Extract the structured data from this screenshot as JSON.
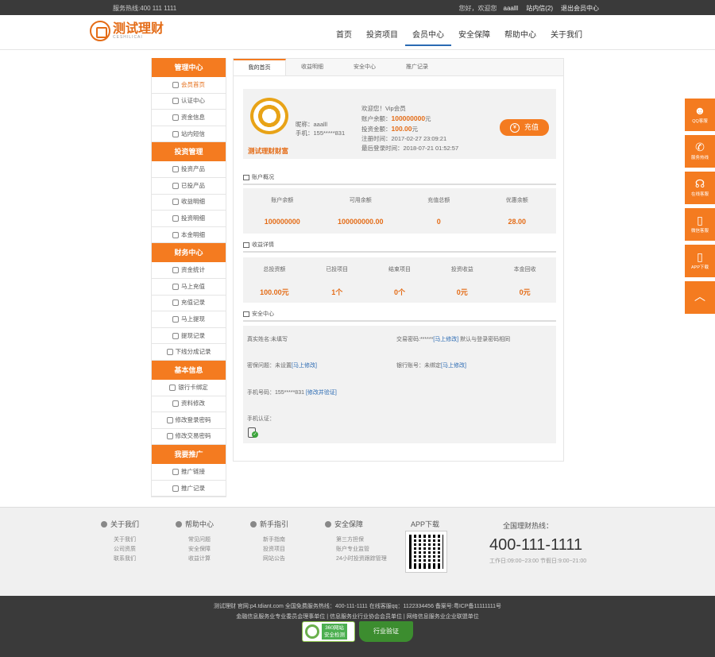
{
  "topbar": {
    "hotline": "服务热线:400 111 1111",
    "greeting": "您好，欢迎您",
    "username": "aaalll",
    "messages": "站内信(2)",
    "logout": "退出会员中心"
  },
  "header": {
    "logo_text": "测试理财",
    "logo_sub": "CESHILICAI",
    "nav": [
      "首页",
      "投资项目",
      "会员中心",
      "安全保障",
      "帮助中心",
      "关于我们"
    ],
    "active_nav": "会员中心"
  },
  "sidebar": {
    "groups": [
      {
        "title": "管理中心",
        "items": [
          "会员首页",
          "认证中心",
          "资金信息",
          "站内短信"
        ]
      },
      {
        "title": "投资管理",
        "items": [
          "投资产品",
          "已投产品",
          "收益明细",
          "投资明细",
          "本金明细"
        ]
      },
      {
        "title": "财务中心",
        "items": [
          "资金统计",
          "马上充值",
          "充值记录",
          "马上提现",
          "提现记录",
          "下线分成记录"
        ]
      },
      {
        "title": "基本信息",
        "items": [
          "银行卡绑定",
          "资料修改",
          "修改登录密码",
          "修改交易密码"
        ]
      },
      {
        "title": "我要推广",
        "items": [
          "推广链接",
          "推广记录"
        ]
      }
    ]
  },
  "tabs": [
    "我的首页",
    "收益明细",
    "安全中心",
    "推广记录"
  ],
  "user": {
    "brand_name": "测试理财财富",
    "nickname": "昵称：aaalll",
    "phone": "手机：155*****831",
    "welcome": "欢迎您！Vip会员",
    "balance_label": "账户余额：",
    "balance_value": "100000000",
    "balance_unit": "元",
    "invest_label": "投资金额：",
    "invest_value": "100.00",
    "invest_unit": "元",
    "register_time": "注册时间：2017-02-27 23:09:21",
    "last_login": "最后登录时间：2018-07-21 01:52:57",
    "recharge_button": "充值",
    "coin_glyph": "¥"
  },
  "account": {
    "title": "账户概况",
    "stats": [
      {
        "label": "账户余额",
        "value": "100000000"
      },
      {
        "label": "可用余额",
        "value": "100000000.00"
      },
      {
        "label": "充值总额",
        "value": "0"
      },
      {
        "label": "优惠余额",
        "value": "28.00"
      }
    ]
  },
  "income": {
    "title": "收益详情",
    "stats": [
      {
        "label": "总投资额",
        "value": "100.00元"
      },
      {
        "label": "已投项目",
        "value": "1个"
      },
      {
        "label": "结束项目",
        "value": "0个"
      },
      {
        "label": "投资收益",
        "value": "0元"
      },
      {
        "label": "本金回收",
        "value": "0元"
      }
    ]
  },
  "security": {
    "title": "安全中心",
    "realname": "真实姓名:未填写",
    "trade_pwd": "交易密码:******",
    "trade_pwd_link": "[马上修改]",
    "trade_pwd_note": "默认与登录密码相同",
    "secret_q": "密保问题：未设置",
    "secret_q_link": "[马上修改]",
    "bank": "银行账号：未绑定",
    "bank_link": "[马上修改]",
    "mobile": "手机号码：155*****831",
    "mobile_link": "[修改并验证]",
    "mobile_auth": "手机认证："
  },
  "float_bar": [
    {
      "label": "QQ客服",
      "glyph": "☻"
    },
    {
      "label": "服务热线",
      "glyph": "✆"
    },
    {
      "label": "在线客服",
      "glyph": "☊"
    },
    {
      "label": "微信客服",
      "glyph": "▯"
    },
    {
      "label": "APP下载",
      "glyph": "▯"
    },
    {
      "label": "",
      "glyph": "︿"
    }
  ],
  "footer": {
    "cols": [
      {
        "title": "关于我们",
        "links": [
          "关于我们",
          "公司资质",
          "联系我们"
        ]
      },
      {
        "title": "帮助中心",
        "links": [
          "常见问题",
          "安全保障",
          "收益计算"
        ]
      },
      {
        "title": "新手指引",
        "links": [
          "新手指南",
          "投资项目",
          "网站公告"
        ]
      },
      {
        "title": "安全保障",
        "links": [
          "第三方担保",
          "账户专业监管",
          "24小时投资跟踪管理"
        ]
      }
    ],
    "app_title": "APP下载",
    "hotline_title": "全国理财热线：",
    "hotline_number": "400-111-1111",
    "hotline_time": "工作日:09:00~23:00 节假日:9:00~21:00"
  },
  "bottom": {
    "line1": "测试理财 官网:p4.tdiant.com 全国免费服务热线：400-111-1111 在线客服qq：1122334456 备案号:粤ICP备11111111号",
    "line2": "金融信息服务业专业委员会理事单位 | 信息服务业行业协会会员单位 | 网络信息服务业企业联盟单位",
    "badge1": "360网站\n安全检测",
    "badge2": "行业验证"
  }
}
